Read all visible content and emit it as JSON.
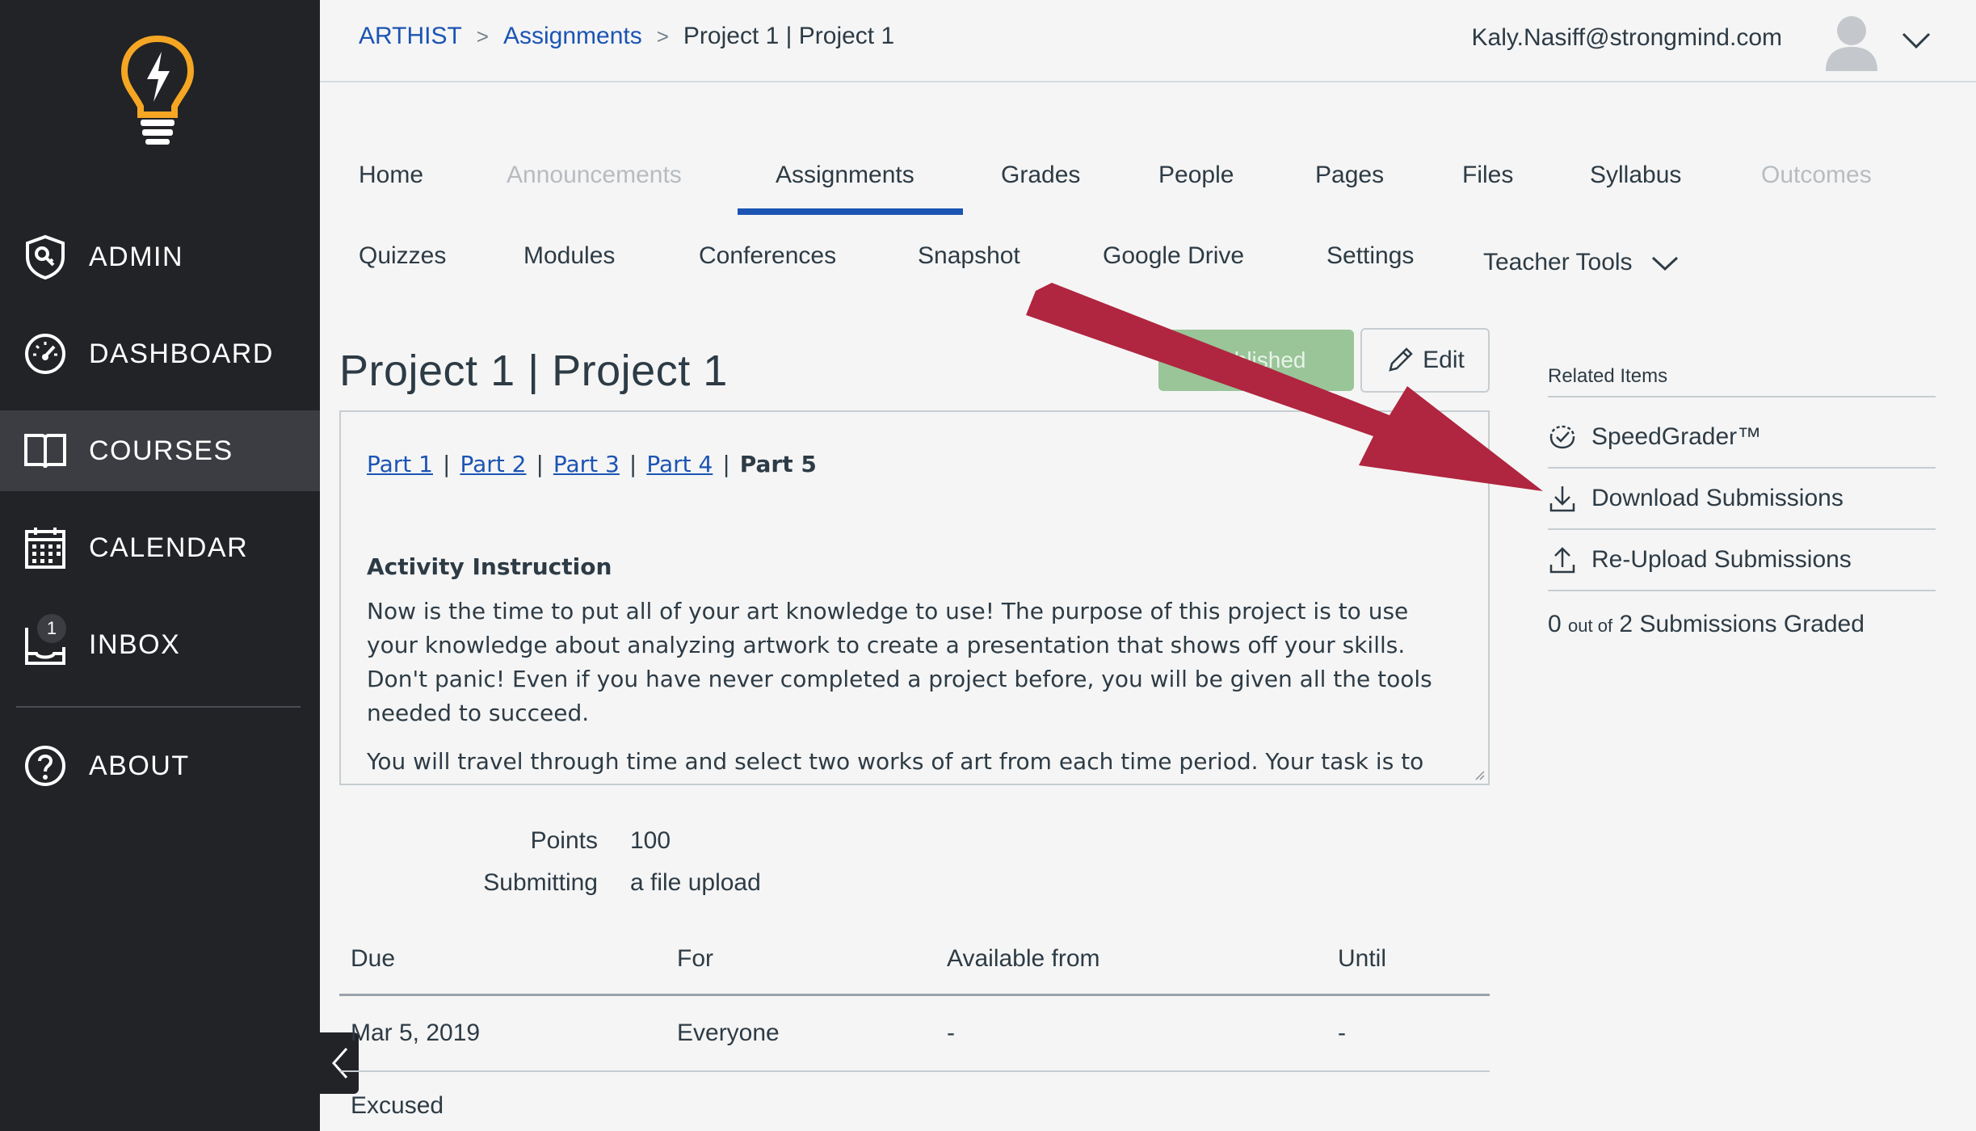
{
  "global_nav": {
    "items": [
      {
        "label": "ADMIN",
        "icon": "admin-shield-icon"
      },
      {
        "label": "DASHBOARD",
        "icon": "dashboard-gauge-icon"
      },
      {
        "label": "COURSES",
        "icon": "book-icon",
        "active": true
      },
      {
        "label": "CALENDAR",
        "icon": "calendar-icon"
      },
      {
        "label": "INBOX",
        "icon": "inbox-icon",
        "badge": "1"
      },
      {
        "label": "ABOUT",
        "icon": "help-circle-icon"
      }
    ]
  },
  "header": {
    "breadcrumbs": [
      "ARTHIST",
      "Assignments",
      "Project 1 | Project 1"
    ],
    "user_email": "Kaly.Nasiff@strongmind.com"
  },
  "course_nav": {
    "row1": [
      "Home",
      "Announcements",
      "Assignments",
      "Grades",
      "People",
      "Pages",
      "Files",
      "Syllabus",
      "Outcomes"
    ],
    "row2": [
      "Quizzes",
      "Modules",
      "Conferences",
      "Snapshot",
      "Google Drive",
      "Settings",
      "Teacher Tools"
    ],
    "active": "Assignments",
    "disabled": [
      "Announcements",
      "Outcomes"
    ]
  },
  "assignment": {
    "title": "Project 1 | Project 1",
    "publish_label": "Published",
    "edit_label": "Edit",
    "parts": [
      "Part 1",
      "Part 2",
      "Part 3",
      "Part 4"
    ],
    "current_part": "Part 5",
    "instruction_heading": "Activity Instruction",
    "paragraph_1": "Now is the time to put all of your art knowledge to use! The purpose of this project is to use your knowledge about analyzing artwork to create a presentation that shows off your skills. Don't panic! Even if you have never completed a project before, you will be given all the tools needed to succeed.",
    "paragraph_2": "You will travel through time and select two works of art from each time period. Your task is to analyze and present these works of art in a slideshow format. You are required to look at the artworks and use",
    "points_label": "Points",
    "points_value": "100",
    "submitting_label": "Submitting",
    "submitting_value": "a file upload"
  },
  "due_table": {
    "headers": [
      "Due",
      "For",
      "Available from",
      "Until"
    ],
    "row": [
      "Mar 5, 2019",
      "Everyone",
      "-",
      "-"
    ],
    "excused_label": "Excused"
  },
  "sidebar": {
    "related_title": "Related Items",
    "items": [
      {
        "label": "SpeedGrader™",
        "icon": "speedgrader-icon"
      },
      {
        "label": "Download Submissions",
        "icon": "download-icon"
      },
      {
        "label": "Re-Upload Submissions",
        "icon": "upload-icon"
      }
    ],
    "graded_count": "0",
    "graded_of": "out of",
    "graded_rest": "2 Submissions Graded"
  },
  "colors": {
    "nav_bg": "#222327",
    "link_blue": "#1c54b4",
    "publish_green": "#99c599",
    "annotation_arrow": "#b0253f"
  }
}
